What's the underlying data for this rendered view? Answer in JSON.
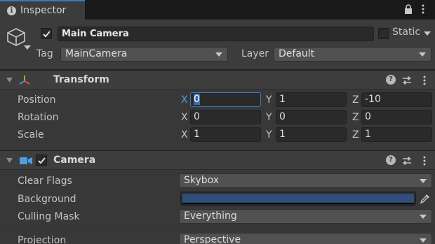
{
  "tab": {
    "title": "Inspector"
  },
  "gameobject": {
    "active": true,
    "name": "Main Camera",
    "static_label": "Static",
    "tag_label": "Tag",
    "tag_value": "MainCamera",
    "layer_label": "Layer",
    "layer_value": "Default"
  },
  "transform": {
    "title": "Transform",
    "position": {
      "label": "Position",
      "x": "0",
      "y": "1",
      "z": "-10"
    },
    "rotation": {
      "label": "Rotation",
      "x": "0",
      "y": "0",
      "z": "0"
    },
    "scale": {
      "label": "Scale",
      "x": "1",
      "y": "1",
      "z": "1"
    },
    "axis_labels": {
      "x": "X",
      "y": "Y",
      "z": "Z"
    }
  },
  "camera": {
    "enabled": true,
    "title": "Camera",
    "clear_flags": {
      "label": "Clear Flags",
      "value": "Skybox"
    },
    "background": {
      "label": "Background",
      "color": "#314d79"
    },
    "culling_mask": {
      "label": "Culling Mask",
      "value": "Everything"
    },
    "projection": {
      "label": "Projection",
      "value": "Perspective"
    }
  },
  "colors": {
    "accent": "#3a79bb",
    "panel": "#383838",
    "header": "#3e3e3e"
  },
  "icons": {
    "tab": "info-icon",
    "lock": "lock-icon",
    "menu": "kebab-menu-icon",
    "gameobject": "cube-icon",
    "transform": "transform-axes-icon",
    "camera": "camera-icon",
    "help": "help-icon",
    "preset": "preset-sliders-icon",
    "eyedropper": "eyedropper-icon"
  }
}
